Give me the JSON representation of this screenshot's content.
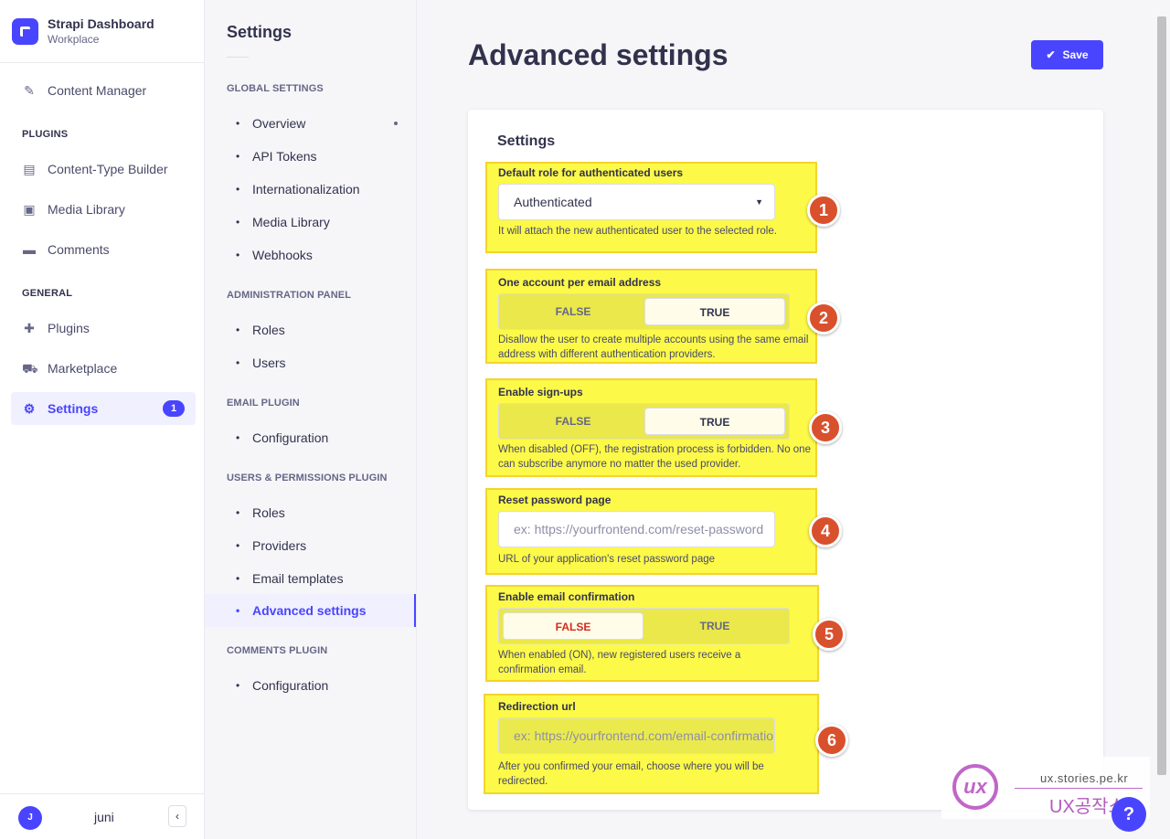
{
  "brand": {
    "title": "Strapi Dashboard",
    "subtitle": "Workplace"
  },
  "mainnav": {
    "content_manager": "Content Manager",
    "plugins_section": "PLUGINS",
    "content_type_builder": "Content-Type Builder",
    "media_library": "Media Library",
    "comments": "Comments",
    "general_section": "GENERAL",
    "plugins": "Plugins",
    "marketplace": "Marketplace",
    "settings": "Settings",
    "settings_badge": "1"
  },
  "user": {
    "initial": "J",
    "name": "juni",
    "collapse": "‹"
  },
  "subnav": {
    "title": "Settings",
    "global_section": "GLOBAL SETTINGS",
    "overview": "Overview",
    "api_tokens": "API Tokens",
    "internationalization": "Internationalization",
    "media_library": "Media Library",
    "webhooks": "Webhooks",
    "admin_section": "ADMINISTRATION PANEL",
    "roles": "Roles",
    "users": "Users",
    "email_section": "EMAIL PLUGIN",
    "email_configuration": "Configuration",
    "up_section": "USERS & PERMISSIONS PLUGIN",
    "up_roles": "Roles",
    "providers": "Providers",
    "email_templates": "Email templates",
    "advanced_settings": "Advanced settings",
    "comments_section": "COMMENTS PLUGIN",
    "comments_configuration": "Configuration"
  },
  "main": {
    "title": "Advanced settings",
    "save": "Save",
    "card_title": "Settings"
  },
  "fields": {
    "default_role": {
      "label": "Default role for authenticated users",
      "value": "Authenticated",
      "hint": "It will attach the new authenticated user to the selected role."
    },
    "unique_email": {
      "label": "One account per email address",
      "false": "FALSE",
      "true": "TRUE",
      "selected": "TRUE",
      "hint": "Disallow the user to create multiple accounts using the same email address with different authentication providers."
    },
    "allow_register": {
      "label": "Enable sign-ups",
      "false": "FALSE",
      "true": "TRUE",
      "selected": "TRUE",
      "hint": "When disabled (OFF), the registration process is forbidden. No one can subscribe anymore no matter the used provider."
    },
    "reset_password": {
      "label": "Reset password page",
      "placeholder": "ex: https://yourfrontend.com/reset-password",
      "hint": "URL of your application's reset password page"
    },
    "email_confirmation": {
      "label": "Enable email confirmation",
      "false": "FALSE",
      "true": "TRUE",
      "selected": "FALSE",
      "hint": "When enabled (ON), new registered users receive a confirmation email."
    },
    "redirect_url": {
      "label": "Redirection url",
      "placeholder": "ex: https://yourfrontend.com/email-confirmation",
      "hint": "After you confirmed your email, choose where you will be redirected."
    }
  },
  "steps": [
    "1",
    "2",
    "3",
    "4",
    "5",
    "6"
  ],
  "watermark": {
    "logo": "ux",
    "url": "ux.stories.pe.kr",
    "name": "UX공작소"
  },
  "help": "?",
  "colors": {
    "accent": "#4945ff",
    "highlight": "#fcf949",
    "step": "#d9502d",
    "danger": "#d02b20"
  }
}
